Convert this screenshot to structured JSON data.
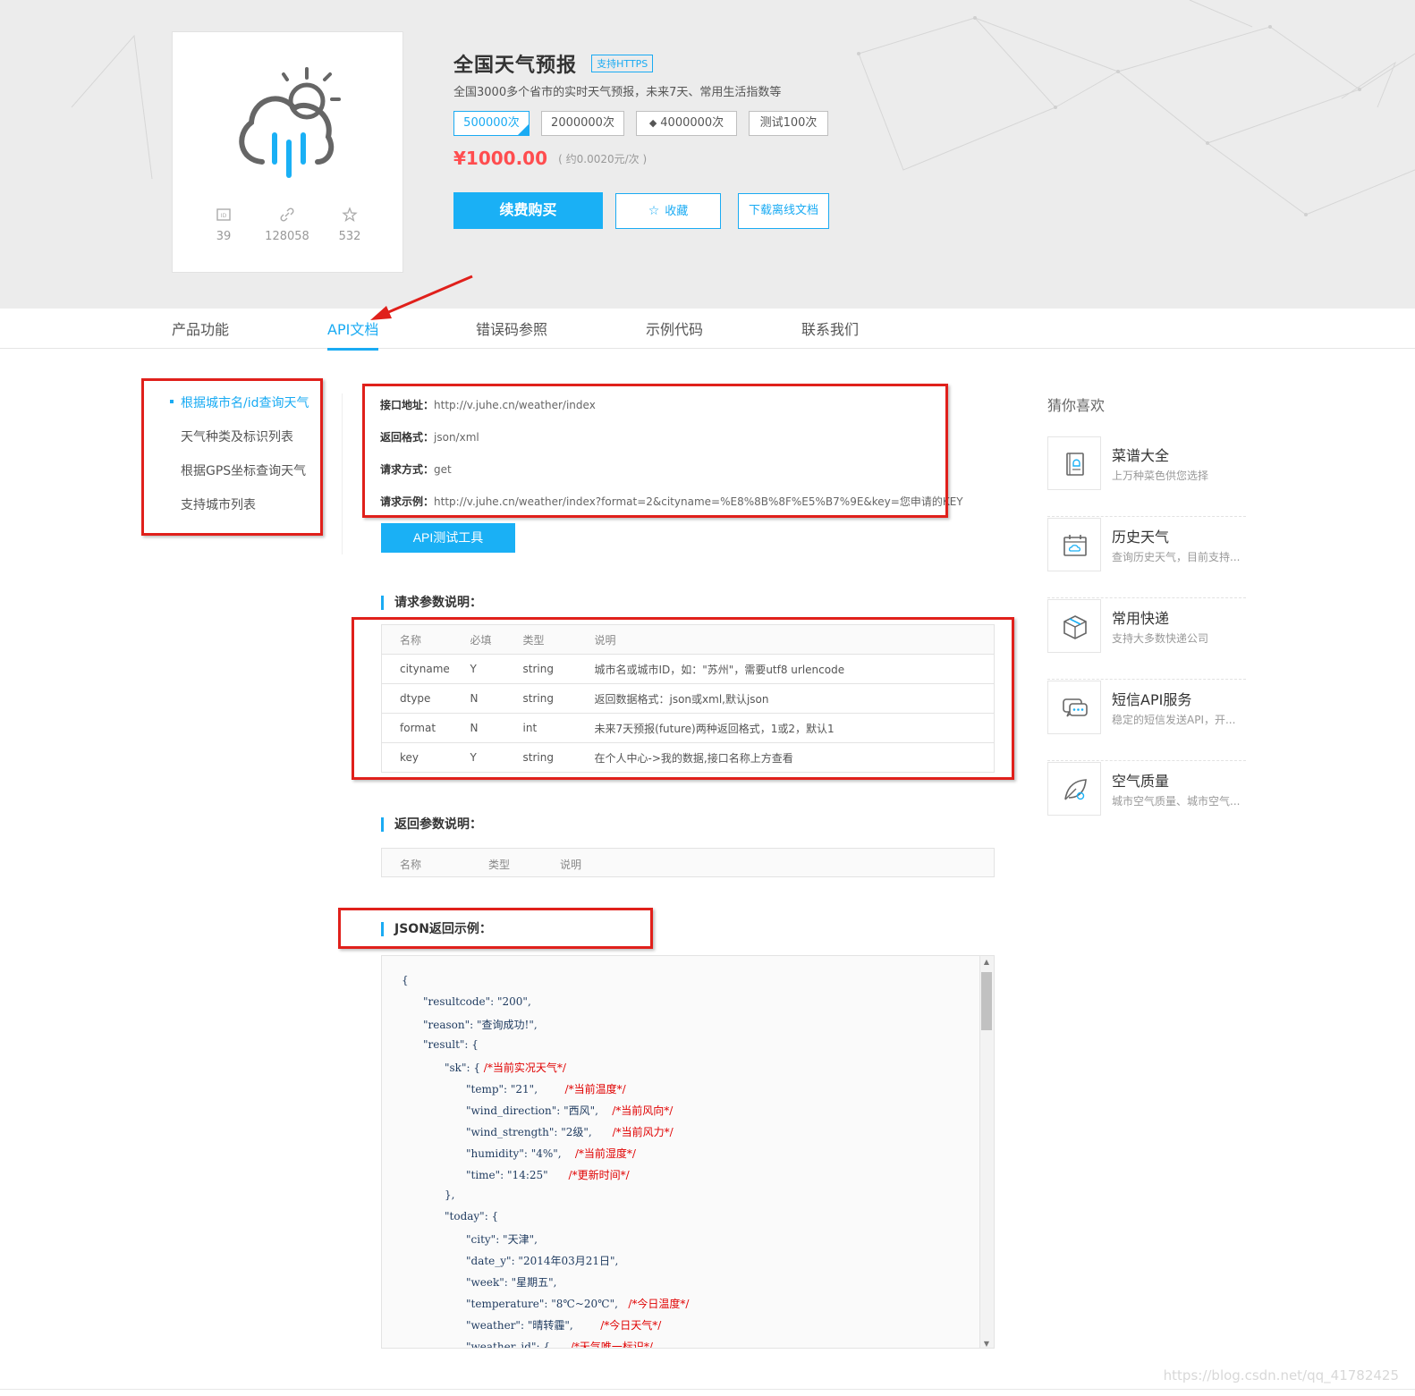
{
  "product": {
    "title": "全国天气预报",
    "https_badge": "支持HTTPS",
    "subtitle": "全国3000多个省市的实时天气预报，未来7天、常用生活指数等",
    "stats": [
      {
        "icon": "id-icon",
        "value": "39"
      },
      {
        "icon": "link-icon",
        "value": "128058"
      },
      {
        "icon": "star-icon",
        "value": "532"
      }
    ],
    "packages": [
      {
        "label": "500000次",
        "active": true
      },
      {
        "label": "2000000次",
        "active": false
      },
      {
        "label": "4000000次",
        "active": false,
        "icon": "diamond-icon"
      },
      {
        "label": "测试100次",
        "active": false
      }
    ],
    "price": "¥1000.00",
    "unit_price": "( 约0.0020元/次 )",
    "buy_label": "续费购买",
    "fav_label": "收藏",
    "download_label": "下载离线文档"
  },
  "tabs": [
    {
      "label": "产品功能",
      "active": false
    },
    {
      "label": "API文档",
      "active": true
    },
    {
      "label": "错误码参照",
      "active": false
    },
    {
      "label": "示例代码",
      "active": false
    },
    {
      "label": "联系我们",
      "active": false
    }
  ],
  "sidebar": {
    "items": [
      {
        "label": "根据城市名/id查询天气",
        "active": true
      },
      {
        "label": "天气种类及标识列表",
        "active": false
      },
      {
        "label": "根据GPS坐标查询天气",
        "active": false
      },
      {
        "label": "支持城市列表",
        "active": false
      }
    ]
  },
  "api": {
    "url_label": "接口地址：",
    "url": "http://v.juhe.cn/weather/index",
    "format_label": "返回格式：",
    "format": "json/xml",
    "method_label": "请求方式：",
    "method": "get",
    "example_label": "请求示例：",
    "example": "http://v.juhe.cn/weather/index?format=2&cityname=%E8%8B%8F%E5%B7%9E&key=您申请的KEY",
    "test_button": "API测试工具"
  },
  "request_params": {
    "title": "请求参数说明：",
    "headers": [
      "名称",
      "必填",
      "类型",
      "说明"
    ],
    "rows": [
      [
        "cityname",
        "Y",
        "string",
        "城市名或城市ID，如：\"苏州\"，需要utf8 urlencode"
      ],
      [
        "dtype",
        "N",
        "string",
        "返回数据格式：json或xml,默认json"
      ],
      [
        "format",
        "N",
        "int",
        "未来7天预报(future)两种返回格式，1或2，默认1"
      ],
      [
        "key",
        "Y",
        "string",
        "在个人中心->我的数据,接口名称上方查看"
      ]
    ]
  },
  "return_params": {
    "title": "返回参数说明：",
    "headers": [
      "名称",
      "类型",
      "说明"
    ]
  },
  "json_example": {
    "title": "JSON返回示例：",
    "lines": [
      {
        "indent": 0,
        "text": "{",
        "comment": ""
      },
      {
        "indent": 1,
        "text": "\"resultcode\": \"200\",",
        "comment": ""
      },
      {
        "indent": 1,
        "text": "\"reason\": \"查询成功!\",",
        "comment": ""
      },
      {
        "indent": 1,
        "text": "\"result\": {",
        "comment": ""
      },
      {
        "indent": 2,
        "text": "\"sk\": { ",
        "comment": "/*当前实况天气*/"
      },
      {
        "indent": 3,
        "text": "\"temp\": \"21\",        ",
        "comment": "/*当前温度*/"
      },
      {
        "indent": 3,
        "text": "\"wind_direction\": \"西风\",    ",
        "comment": "/*当前风向*/"
      },
      {
        "indent": 3,
        "text": "\"wind_strength\": \"2级\",      ",
        "comment": "/*当前风力*/"
      },
      {
        "indent": 3,
        "text": "\"humidity\": \"4%\",    ",
        "comment": "/*当前湿度*/"
      },
      {
        "indent": 3,
        "text": "\"time\": \"14:25\"      ",
        "comment": "/*更新时间*/"
      },
      {
        "indent": 2,
        "text": "},",
        "comment": ""
      },
      {
        "indent": 2,
        "text": "\"today\": {",
        "comment": ""
      },
      {
        "indent": 3,
        "text": "\"city\": \"天津\",",
        "comment": ""
      },
      {
        "indent": 3,
        "text": "\"date_y\": \"2014年03月21日\",",
        "comment": ""
      },
      {
        "indent": 3,
        "text": "\"week\": \"星期五\",",
        "comment": ""
      },
      {
        "indent": 3,
        "text": "\"temperature\": \"8℃~20℃\",   ",
        "comment": "/*今日温度*/"
      },
      {
        "indent": 3,
        "text": "\"weather\": \"晴转霾\",        ",
        "comment": "/*今日天气*/"
      },
      {
        "indent": 3,
        "text": "\"weather_id\": {      ",
        "comment": "/*天气唯一标识*/"
      }
    ]
  },
  "recommend": {
    "title": "猜你喜欢",
    "items": [
      {
        "icon": "recipe-book-icon",
        "name": "菜谱大全",
        "desc": "上万种菜色供您选择"
      },
      {
        "icon": "calendar-weather-icon",
        "name": "历史天气",
        "desc": "查询历史天气，目前支持..."
      },
      {
        "icon": "package-box-icon",
        "name": "常用快递",
        "desc": "支持大多数快递公司"
      },
      {
        "icon": "chat-bubble-icon",
        "name": "短信API服务",
        "desc": "稳定的短信发送API，开..."
      },
      {
        "icon": "leaf-icon",
        "name": "空气质量",
        "desc": "城市空气质量、城市空气..."
      }
    ]
  },
  "watermark": "https://blog.csdn.net/qq_41782425",
  "colors": {
    "accent": "#1aabf3",
    "price": "#ff4d4f",
    "annotation": "#e0201b"
  }
}
